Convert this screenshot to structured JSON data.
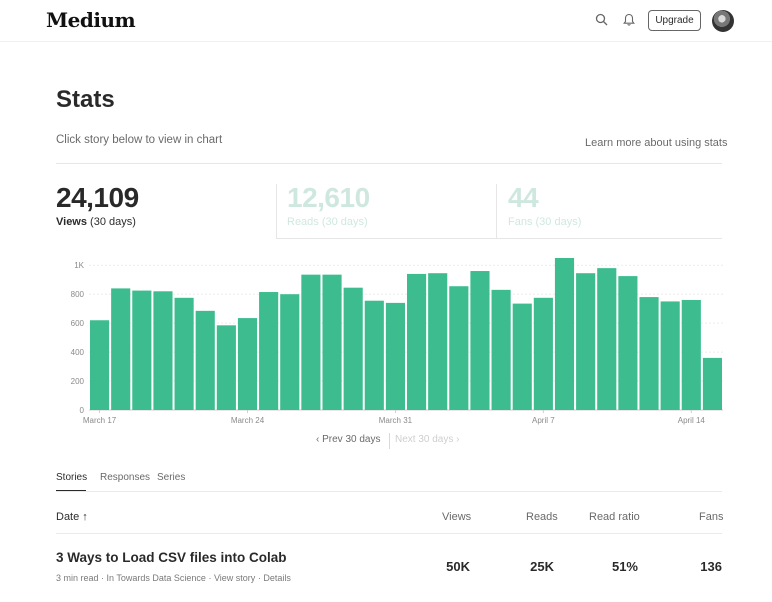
{
  "header": {
    "logo": "Medium",
    "upgrade_label": "Upgrade"
  },
  "page": {
    "title": "Stats",
    "subtitle": "Click story below to view in chart",
    "learn_more": "Learn more about using stats"
  },
  "stats": {
    "views": {
      "value": "24,109",
      "label_bold": "Views",
      "label_rest": " (30 days)"
    },
    "reads": {
      "value": "12,610",
      "label": "Reads (30 days)"
    },
    "fans": {
      "value": "44",
      "label": "Fans (30 days)"
    }
  },
  "chart_data": {
    "type": "bar",
    "title": "",
    "xlabel": "",
    "ylabel": "",
    "ylim": [
      0,
      1050
    ],
    "yticks": [
      0,
      200,
      400,
      600,
      800,
      1000
    ],
    "ytick_labels": [
      "0",
      "200",
      "400",
      "600",
      "800",
      "1K"
    ],
    "xtick_labels": [
      "March 17",
      "March 24",
      "March 31",
      "April 7",
      "April 14"
    ],
    "xtick_indices": [
      0,
      7,
      14,
      21,
      28
    ],
    "categories": [
      "Mar 17",
      "Mar 18",
      "Mar 19",
      "Mar 20",
      "Mar 21",
      "Mar 22",
      "Mar 23",
      "Mar 24",
      "Mar 25",
      "Mar 26",
      "Mar 27",
      "Mar 28",
      "Mar 29",
      "Mar 30",
      "Mar 31",
      "Apr 1",
      "Apr 2",
      "Apr 3",
      "Apr 4",
      "Apr 5",
      "Apr 6",
      "Apr 7",
      "Apr 8",
      "Apr 9",
      "Apr 10",
      "Apr 11",
      "Apr 12",
      "Apr 13",
      "Apr 14",
      "Apr 15"
    ],
    "values": [
      620,
      840,
      825,
      820,
      775,
      685,
      585,
      635,
      815,
      800,
      935,
      935,
      845,
      755,
      740,
      940,
      945,
      855,
      960,
      830,
      735,
      775,
      1050,
      945,
      980,
      925,
      780,
      750,
      760,
      360
    ],
    "bar_color": "#3dbd8f",
    "grid": true
  },
  "pager": {
    "prev": "Prev 30 days",
    "next": "Next 30 days"
  },
  "tabs": [
    "Stories",
    "Responses",
    "Series"
  ],
  "table": {
    "headers": {
      "date": "Date",
      "views": "Views",
      "reads": "Reads",
      "read_ratio": "Read ratio",
      "fans": "Fans"
    },
    "rows": [
      {
        "title": "3 Ways to Load CSV files into Colab",
        "read_time": "3 min read",
        "publication": "In Towards Data Science",
        "view_story": "View story",
        "details": "Details",
        "views": "50K",
        "reads": "25K",
        "read_ratio": "51%",
        "fans": "136"
      }
    ]
  },
  "colors": {
    "accent": "#3dbd8f",
    "muted_accent": "#cfe8df"
  }
}
